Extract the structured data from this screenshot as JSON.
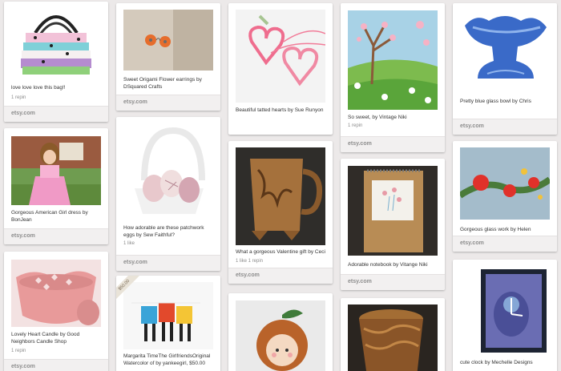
{
  "source_label": "etsy.com",
  "pins": [
    {
      "id": "bag",
      "description": "love love love this bag!!",
      "stats": "1 repin"
    },
    {
      "id": "earrings",
      "description": "Sweet Origami Flower earrings by DSquared Crafts",
      "stats": ""
    },
    {
      "id": "hearts",
      "description": "Beautiful tatted hearts by Sue Runyon",
      "stats": ""
    },
    {
      "id": "painting",
      "description": "So sweet, by Vintage Niki",
      "stats": "1 repin"
    },
    {
      "id": "bowl",
      "description": "Pretty blue glass bowl by Chris",
      "stats": ""
    },
    {
      "id": "doll",
      "description": "Gorgeous American Girl dress by BonJean",
      "stats": ""
    },
    {
      "id": "eggs",
      "description": "How adorable are these patchwork eggs by Sew Faithful?",
      "stats": "1 like"
    },
    {
      "id": "mug",
      "description": "What a gorgeous Valentine gift by Ceci",
      "stats": "1 like  1 repin"
    },
    {
      "id": "notebook",
      "description": "Adorable notebook by Vitange Niki",
      "stats": ""
    },
    {
      "id": "glasswork",
      "description": "Gorgeous glass work by Helen",
      "stats": ""
    },
    {
      "id": "candle",
      "description": "Lovely Heart Candle by Good Neighbors Candle Shop",
      "stats": "1 repin"
    },
    {
      "id": "watercolor",
      "description": "Margarita TimeThe GirlfriendsOriginal Watercolor of by yankeegirl, $50.00",
      "stats": "",
      "price_badge": "$50.00"
    },
    {
      "id": "feltdoll",
      "description": "",
      "stats": ""
    },
    {
      "id": "cup",
      "description": "",
      "stats": ""
    },
    {
      "id": "clock",
      "description": "cute clock by Mechelle Designs",
      "stats": ""
    }
  ]
}
